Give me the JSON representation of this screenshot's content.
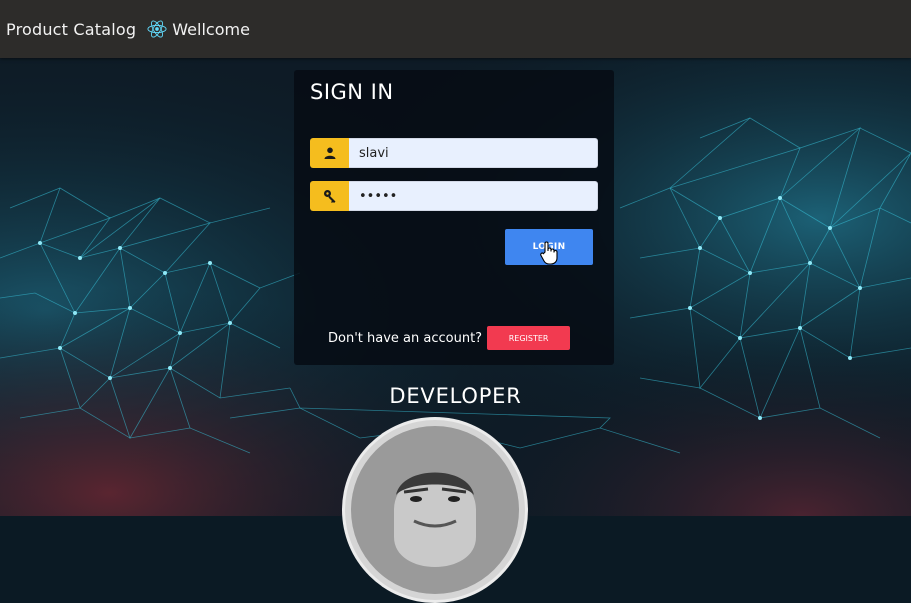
{
  "navbar": {
    "brand": "Product Catalog",
    "welcome": "Wellcome"
  },
  "signin": {
    "title": "SIGN IN",
    "username_value": "slavi",
    "password_value": "slavi",
    "login_label": "LOGIN",
    "register_prompt": "Don't have an account?",
    "register_label": "REGISTER"
  },
  "developer": {
    "title": "DEVELOPER"
  },
  "colors": {
    "navbar": "#2d2c2a",
    "addon": "#f5bd1e",
    "login": "#3f86f0",
    "register": "#f23a50"
  },
  "icons": [
    "react-logo-icon",
    "user-icon",
    "key-icon",
    "hand-cursor-icon"
  ]
}
